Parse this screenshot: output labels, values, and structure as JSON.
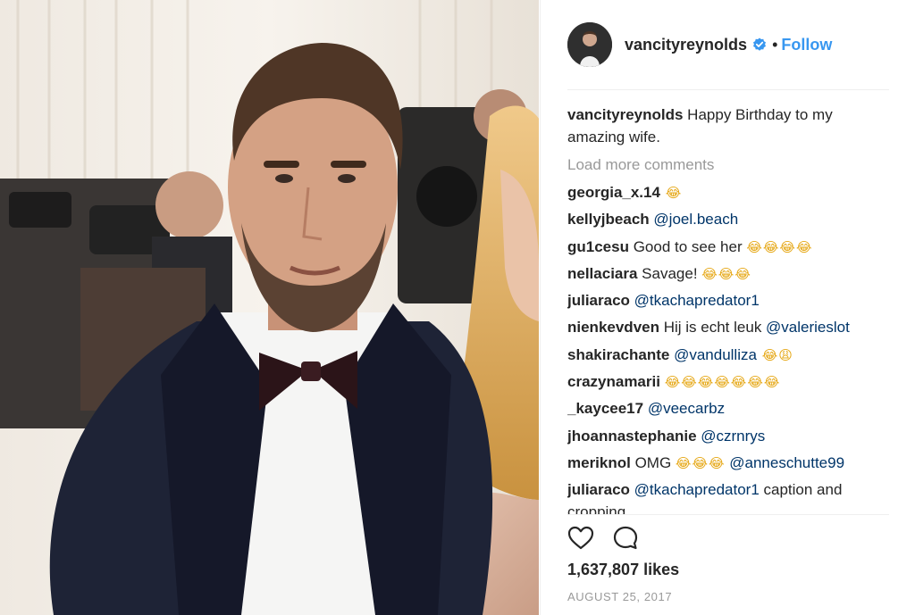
{
  "post": {
    "username": "vancityreynolds",
    "verified": true,
    "separator": "•",
    "follow_label": "Follow",
    "caption_username": "vancityreynolds",
    "caption_text": " Happy Birthday to my amazing wife.",
    "load_more_label": "Load more comments",
    "likes": "1,637,807 likes",
    "date": "AUGUST 25, 2017"
  },
  "comments": [
    {
      "user": "georgia_x.14",
      "text": "",
      "mention": "",
      "emoji": " 😂",
      "tail": ""
    },
    {
      "user": "kellyjbeach",
      "text": " ",
      "mention": "@joel.beach",
      "emoji": "",
      "tail": ""
    },
    {
      "user": "gu1cesu",
      "text": " Good to see her ",
      "mention": "",
      "emoji": "😂😂😂😂",
      "tail": ""
    },
    {
      "user": "nellaciara",
      "text": " Savage! ",
      "mention": "",
      "emoji": "😂😂😂",
      "tail": ""
    },
    {
      "user": "juliaraco",
      "text": " ",
      "mention": "@tkachapredator1",
      "emoji": "",
      "tail": ""
    },
    {
      "user": "nienkevdven",
      "text": " Hij is echt leuk ",
      "mention": "@valerieslot",
      "emoji": "",
      "tail": ""
    },
    {
      "user": "shakirachante",
      "text": " ",
      "mention": "@vandulliza",
      "emoji": " 😂😩",
      "tail": ""
    },
    {
      "user": "crazynamarii",
      "text": " ",
      "mention": "",
      "emoji": "😂😂😂😂😂😂😂",
      "tail": ""
    },
    {
      "user": "_kaycee17",
      "text": " ",
      "mention": "@veecarbz",
      "emoji": "",
      "tail": ""
    },
    {
      "user": "jhoannastephanie",
      "text": " ",
      "mention": "@czrnrys",
      "emoji": "",
      "tail": ""
    },
    {
      "user": "meriknol",
      "text": " OMG ",
      "mention": "",
      "emoji": "😂😂😂",
      "tail": " @anneschutte99"
    },
    {
      "user": "juliaraco",
      "text": " ",
      "mention": "@tkachapredator1",
      "emoji": "",
      "tail": " caption and cropping"
    }
  ],
  "icons": {
    "like": "heart-icon",
    "comment": "comment-bubble-icon",
    "verified": "verified-badge-icon"
  },
  "colors": {
    "follow": "#3897f0",
    "mention": "#003569",
    "muted": "#999999",
    "verified": "#3897f0"
  }
}
